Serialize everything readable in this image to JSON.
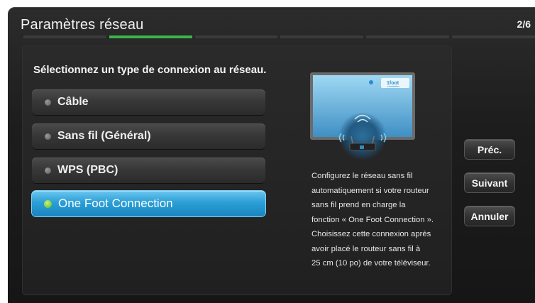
{
  "header": {
    "title": "Paramètres réseau",
    "step": "2/6",
    "progress": {
      "total_segments": 6,
      "active_segment": 2
    }
  },
  "main": {
    "prompt": "Sélectionnez un type de connexion au réseau.",
    "options": [
      {
        "label": "Câble",
        "selected": false
      },
      {
        "label": "Sans fil (Général)",
        "selected": false
      },
      {
        "label": "WPS (PBC)",
        "selected": false
      },
      {
        "label": "One Foot Connection",
        "selected": true
      }
    ],
    "illustration": {
      "logo_text": "1foot",
      "logo_subtext": "connection"
    },
    "description": [
      "Configurez le réseau sans fil",
      "automatiquement si votre routeur",
      "sans fil prend en charge la",
      "fonction « One Foot Connection ».",
      "Choisissez cette connexion après",
      "avoir placé le routeur sans fil à",
      "25 cm (10 po) de votre téléviseur."
    ]
  },
  "side_buttons": {
    "prev": "Préc.",
    "next": "Suivant",
    "cancel": "Annuler"
  },
  "colors": {
    "accent_blue": "#2b9fd6",
    "progress_green": "#39b54a",
    "selected_dot": "#56b82a"
  }
}
